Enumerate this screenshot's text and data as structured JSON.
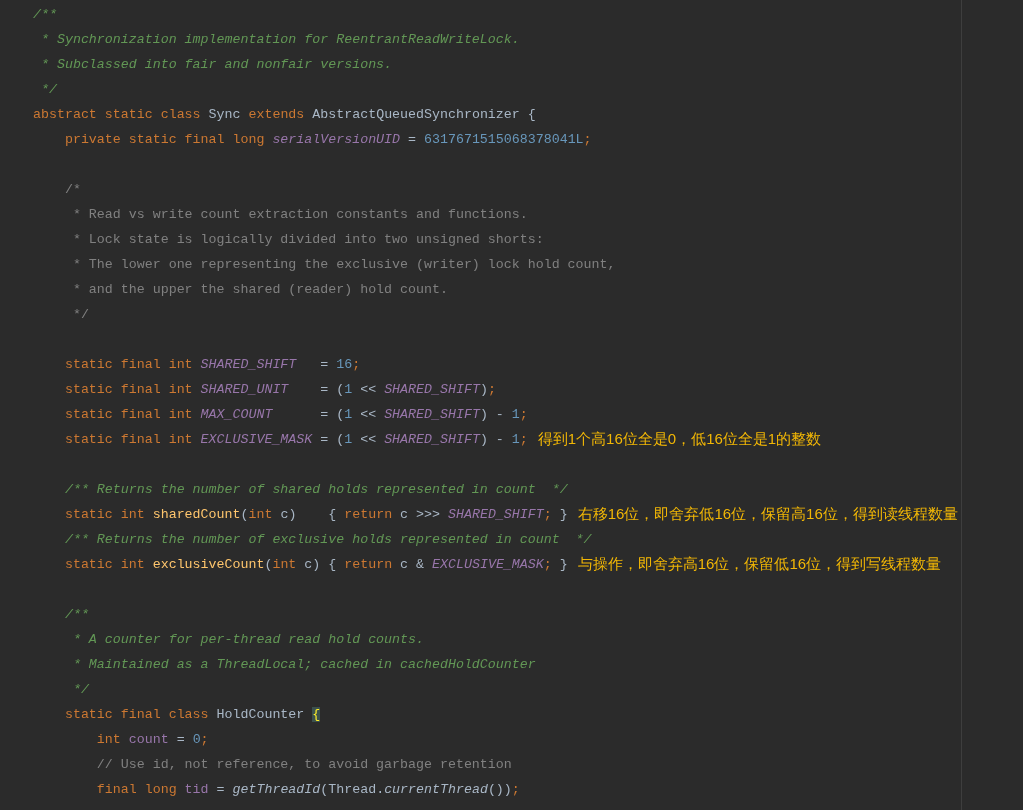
{
  "editor": {
    "lines": [
      {
        "kind": "code",
        "tokens": [
          {
            "kind": "doc",
            "text": "/**"
          }
        ]
      },
      {
        "kind": "code",
        "tokens": [
          {
            "kind": "doc",
            "text": " * Synchronization implementation for ReentrantReadWriteLock."
          }
        ]
      },
      {
        "kind": "code",
        "tokens": [
          {
            "kind": "doc",
            "text": " * Subclassed into fair and nonfair versions."
          }
        ]
      },
      {
        "kind": "code",
        "tokens": [
          {
            "kind": "doc",
            "text": " */"
          }
        ]
      },
      {
        "kind": "code",
        "tokens": [
          {
            "kind": "keyword",
            "text": "abstract static class "
          },
          {
            "kind": "plain",
            "text": "Sync "
          },
          {
            "kind": "keyword",
            "text": "extends "
          },
          {
            "kind": "plain",
            "text": "AbstractQueuedSynchronizer {"
          }
        ]
      },
      {
        "kind": "code",
        "tokens": [
          {
            "kind": "keyword",
            "text": "    private static final long "
          },
          {
            "kind": "static_field",
            "text": "serialVersionUID"
          },
          {
            "kind": "plain",
            "text": " = "
          },
          {
            "kind": "number",
            "text": "6317671515068378041L"
          },
          {
            "kind": "keyword",
            "text": ";"
          }
        ]
      },
      {
        "kind": "blank"
      },
      {
        "kind": "code",
        "tokens": [
          {
            "kind": "comment",
            "text": "    /*"
          }
        ]
      },
      {
        "kind": "code",
        "tokens": [
          {
            "kind": "comment",
            "text": "     * Read vs write count extraction constants and functions."
          }
        ]
      },
      {
        "kind": "code",
        "tokens": [
          {
            "kind": "comment",
            "text": "     * Lock state is logically divided into two unsigned shorts:"
          }
        ]
      },
      {
        "kind": "code",
        "tokens": [
          {
            "kind": "comment",
            "text": "     * The lower one representing the exclusive (writer) lock hold count,"
          }
        ]
      },
      {
        "kind": "code",
        "tokens": [
          {
            "kind": "comment",
            "text": "     * and the upper the shared (reader) hold count."
          }
        ]
      },
      {
        "kind": "code",
        "tokens": [
          {
            "kind": "comment",
            "text": "     */"
          }
        ]
      },
      {
        "kind": "blank"
      },
      {
        "kind": "code",
        "tokens": [
          {
            "kind": "keyword",
            "text": "    static final int "
          },
          {
            "kind": "static_field",
            "text": "SHARED_SHIFT"
          },
          {
            "kind": "plain",
            "text": "   = "
          },
          {
            "kind": "number",
            "text": "16"
          },
          {
            "kind": "keyword",
            "text": ";"
          }
        ]
      },
      {
        "kind": "code",
        "tokens": [
          {
            "kind": "keyword",
            "text": "    static final int "
          },
          {
            "kind": "static_field",
            "text": "SHARED_UNIT"
          },
          {
            "kind": "plain",
            "text": "    = ("
          },
          {
            "kind": "number",
            "text": "1"
          },
          {
            "kind": "plain",
            "text": " << "
          },
          {
            "kind": "static_field",
            "text": "SHARED_SHIFT"
          },
          {
            "kind": "plain",
            "text": ")"
          },
          {
            "kind": "keyword",
            "text": ";"
          }
        ]
      },
      {
        "kind": "code",
        "tokens": [
          {
            "kind": "keyword",
            "text": "    static final int "
          },
          {
            "kind": "static_field",
            "text": "MAX_COUNT"
          },
          {
            "kind": "plain",
            "text": "      = ("
          },
          {
            "kind": "number",
            "text": "1"
          },
          {
            "kind": "plain",
            "text": " << "
          },
          {
            "kind": "static_field",
            "text": "SHARED_SHIFT"
          },
          {
            "kind": "plain",
            "text": ") - "
          },
          {
            "kind": "number",
            "text": "1"
          },
          {
            "kind": "keyword",
            "text": ";"
          }
        ]
      },
      {
        "kind": "code",
        "tokens": [
          {
            "kind": "keyword",
            "text": "    static final int "
          },
          {
            "kind": "static_field",
            "text": "EXCLUSIVE_MASK"
          },
          {
            "kind": "plain",
            "text": " = ("
          },
          {
            "kind": "number",
            "text": "1"
          },
          {
            "kind": "plain",
            "text": " << "
          },
          {
            "kind": "static_field",
            "text": "SHARED_SHIFT"
          },
          {
            "kind": "plain",
            "text": ") - "
          },
          {
            "kind": "number",
            "text": "1"
          },
          {
            "kind": "keyword",
            "text": ";"
          }
        ],
        "note": "得到1个高16位全是0，低16位全是1的整数"
      },
      {
        "kind": "blank"
      },
      {
        "kind": "code",
        "tokens": [
          {
            "kind": "doc",
            "text": "    /** Returns the number of shared holds represented in count  */"
          }
        ]
      },
      {
        "kind": "code",
        "tokens": [
          {
            "kind": "keyword",
            "text": "    static int "
          },
          {
            "kind": "method",
            "text": "sharedCount"
          },
          {
            "kind": "plain",
            "text": "("
          },
          {
            "kind": "keyword",
            "text": "int"
          },
          {
            "kind": "plain",
            "text": " c)    { "
          },
          {
            "kind": "keyword",
            "text": "return"
          },
          {
            "kind": "plain",
            "text": " c >>> "
          },
          {
            "kind": "static_field",
            "text": "SHARED_SHIFT"
          },
          {
            "kind": "keyword",
            "text": ";"
          },
          {
            "kind": "plain",
            "text": " }"
          }
        ],
        "note": "右移16位，即舍弃低16位，保留高16位，得到读线程数量"
      },
      {
        "kind": "code",
        "tokens": [
          {
            "kind": "doc",
            "text": "    /** Returns the number of exclusive holds represented in count  */"
          }
        ]
      },
      {
        "kind": "code",
        "tokens": [
          {
            "kind": "keyword",
            "text": "    static int "
          },
          {
            "kind": "method",
            "text": "exclusiveCount"
          },
          {
            "kind": "plain",
            "text": "("
          },
          {
            "kind": "keyword",
            "text": "int"
          },
          {
            "kind": "plain",
            "text": " c) { "
          },
          {
            "kind": "keyword",
            "text": "return"
          },
          {
            "kind": "plain",
            "text": " c & "
          },
          {
            "kind": "static_field",
            "text": "EXCLUSIVE_MASK"
          },
          {
            "kind": "keyword",
            "text": ";"
          },
          {
            "kind": "plain",
            "text": " }"
          }
        ],
        "note": "与操作，即舍弃高16位，保留低16位，得到写线程数量"
      },
      {
        "kind": "blank"
      },
      {
        "kind": "code",
        "tokens": [
          {
            "kind": "doc",
            "text": "    /**"
          }
        ]
      },
      {
        "kind": "code",
        "tokens": [
          {
            "kind": "doc",
            "text": "     * A counter for per-thread read hold counts."
          }
        ]
      },
      {
        "kind": "code",
        "tokens": [
          {
            "kind": "doc",
            "text": "     * Maintained as a ThreadLocal; cached in cachedHoldCounter"
          }
        ]
      },
      {
        "kind": "code",
        "tokens": [
          {
            "kind": "doc",
            "text": "     */"
          }
        ]
      },
      {
        "kind": "code",
        "tokens": [
          {
            "kind": "keyword",
            "text": "    static final class "
          },
          {
            "kind": "plain",
            "text": "HoldCounter "
          },
          {
            "kind": "brace_match",
            "text": "{"
          }
        ]
      },
      {
        "kind": "code",
        "tokens": [
          {
            "kind": "keyword",
            "text": "        int "
          },
          {
            "kind": "field",
            "text": "count"
          },
          {
            "kind": "plain",
            "text": " = "
          },
          {
            "kind": "number",
            "text": "0"
          },
          {
            "kind": "keyword",
            "text": ";"
          }
        ]
      },
      {
        "kind": "code",
        "tokens": [
          {
            "kind": "comment",
            "text": "        // Use id, not reference, to avoid garbage retention"
          }
        ]
      },
      {
        "kind": "code",
        "tokens": [
          {
            "kind": "keyword",
            "text": "        final long "
          },
          {
            "kind": "field",
            "text": "tid"
          },
          {
            "kind": "plain",
            "text": " = "
          },
          {
            "kind": "static_call",
            "text": "getThreadId"
          },
          {
            "kind": "plain",
            "text": "(Thread."
          },
          {
            "kind": "static_call",
            "text": "currentThread"
          },
          {
            "kind": "plain",
            "text": "())"
          },
          {
            "kind": "keyword",
            "text": ";"
          }
        ]
      }
    ]
  }
}
